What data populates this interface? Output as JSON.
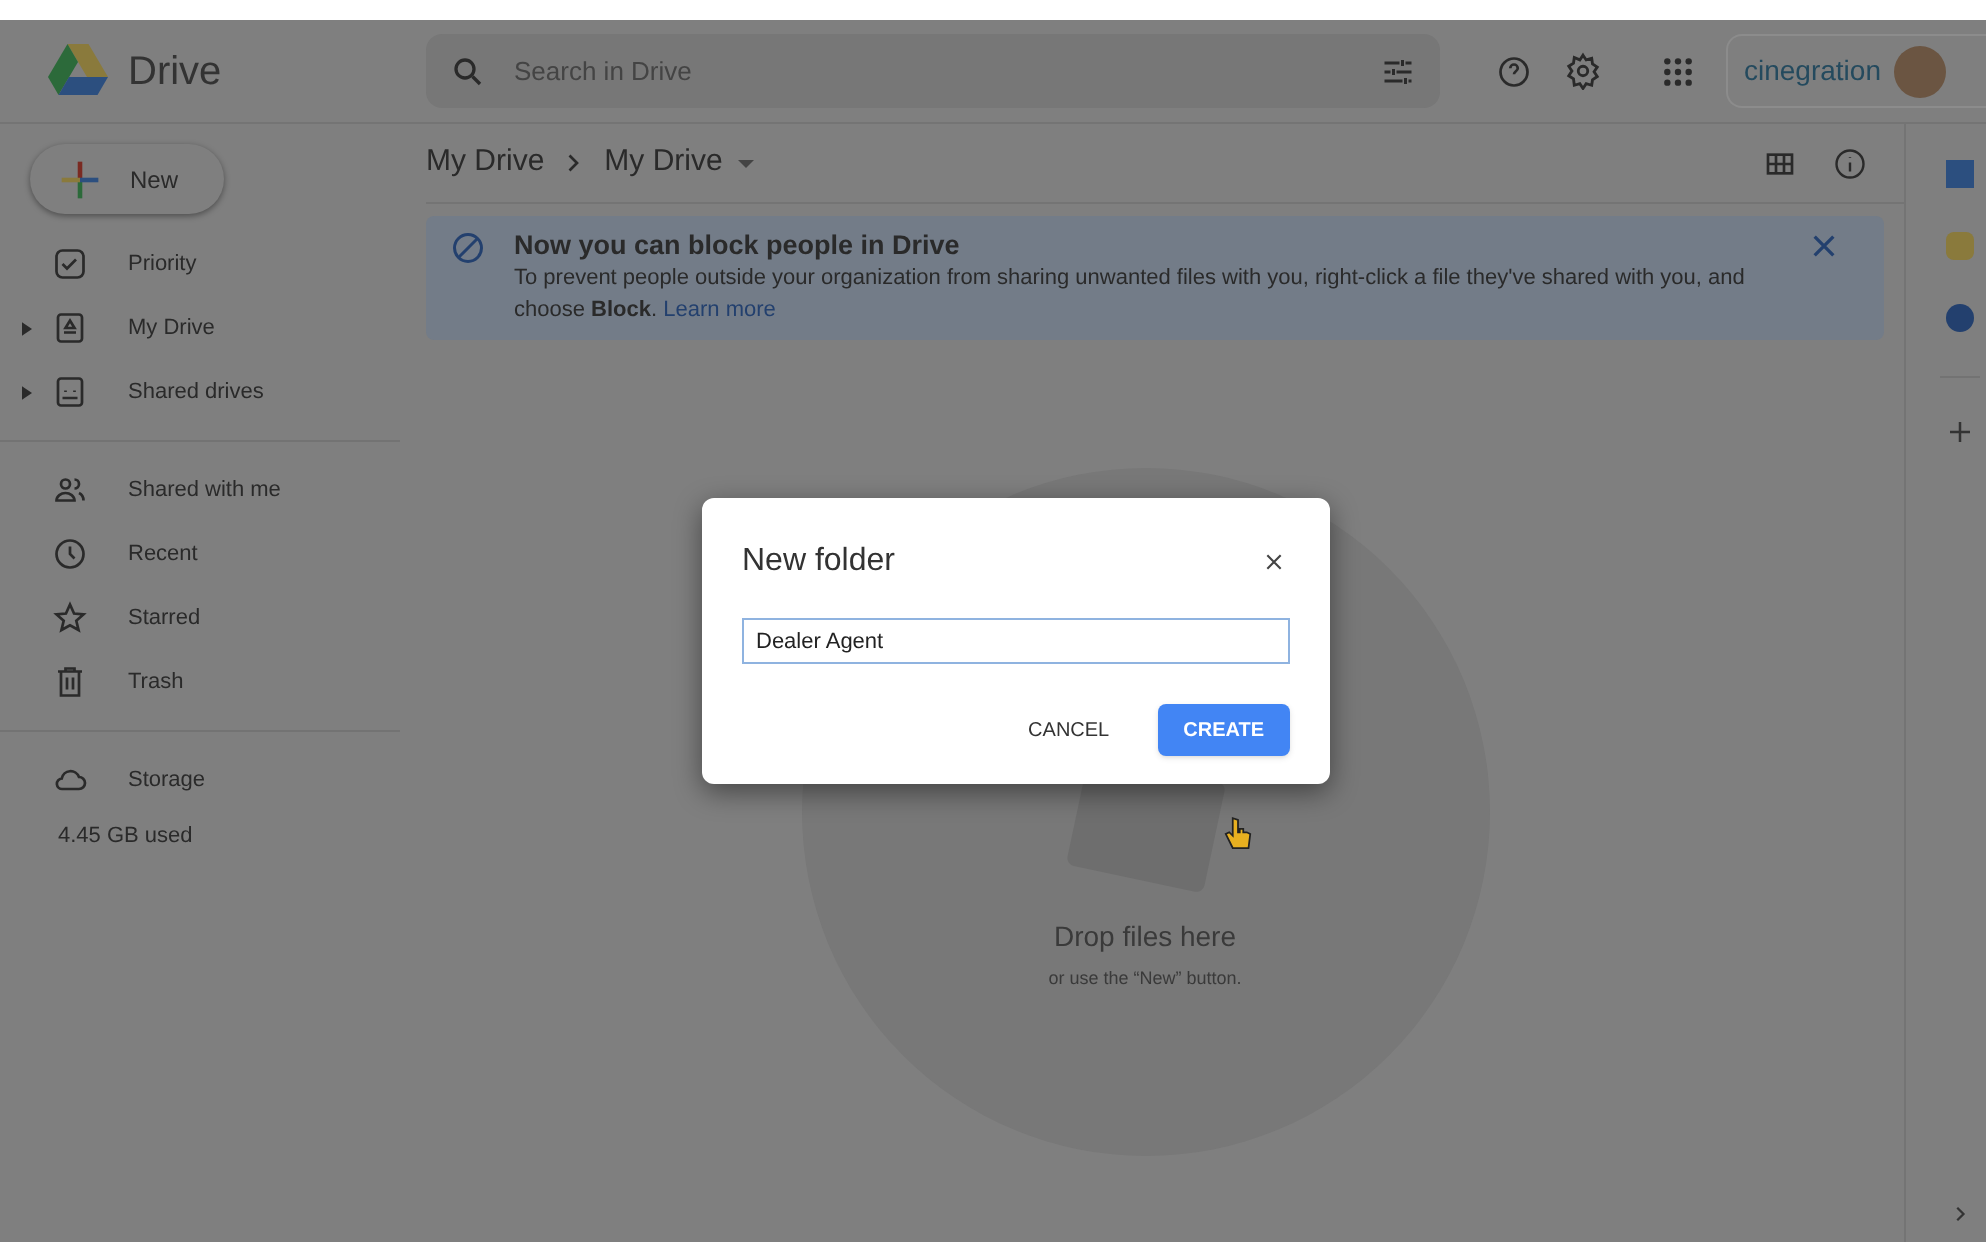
{
  "header": {
    "app_name": "Drive",
    "search_placeholder": "Search in Drive",
    "account_logo": "cinegration"
  },
  "sidebar": {
    "new_button": "New",
    "items": [
      {
        "kind": "item",
        "label": "Priority",
        "expandable": false
      },
      {
        "kind": "item",
        "label": "My Drive",
        "expandable": true
      },
      {
        "kind": "item",
        "label": "Shared drives",
        "expandable": true
      },
      {
        "kind": "divider"
      },
      {
        "kind": "item",
        "label": "Shared with me",
        "expandable": false
      },
      {
        "kind": "item",
        "label": "Recent",
        "expandable": false
      },
      {
        "kind": "item",
        "label": "Starred",
        "expandable": false
      },
      {
        "kind": "item",
        "label": "Trash",
        "expandable": false
      },
      {
        "kind": "divider"
      },
      {
        "kind": "item",
        "label": "Storage",
        "expandable": false
      }
    ],
    "storage_used": "4.45 GB used"
  },
  "breadcrumb": [
    "My Drive",
    "My Drive"
  ],
  "banner": {
    "title": "Now you can block people in Drive",
    "body": "To prevent people outside your organization from sharing unwanted files with you, right-click a file they've shared with you, and choose **Block**.",
    "link": "Learn more"
  },
  "empty_state": {
    "title": "Drop files here",
    "subtitle": "or use the “New” button."
  },
  "dialog": {
    "title": "New folder",
    "value": "Dealer Agent",
    "buttons": [
      {
        "label": "CANCEL",
        "primary": false
      },
      {
        "label": "CREATE",
        "primary": true
      }
    ]
  }
}
